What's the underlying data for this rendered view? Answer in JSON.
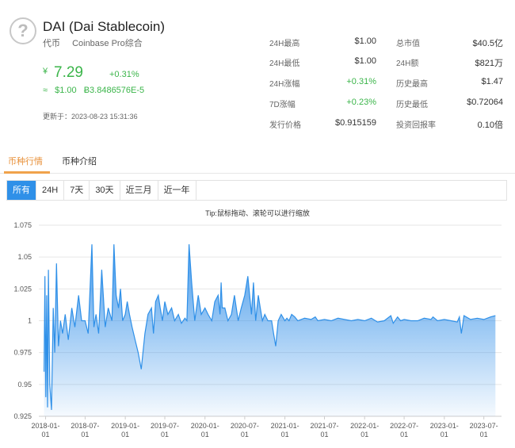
{
  "coin": {
    "icon": "question-mark-icon",
    "title": "DAI (Dai Stablecoin)",
    "type": "代币",
    "exchange": "Coinbase Pro综合",
    "cny_symbol": "¥",
    "price": "7.29",
    "change": "+0.31%",
    "approx_symbol": "≈",
    "usd_price": "$1.00",
    "btc_price": "Ƀ3.8486576E-5",
    "updated": "更新于：2023-08-23 15:31:36"
  },
  "stats_left": [
    {
      "label": "24H最高",
      "value": "$1.00",
      "color": "normal"
    },
    {
      "label": "24H最低",
      "value": "$1.00",
      "color": "normal"
    },
    {
      "label": "24H涨幅",
      "value": "+0.31%",
      "color": "green"
    },
    {
      "label": "7D涨幅",
      "value": "+0.23%",
      "color": "green"
    },
    {
      "label": "发行价格",
      "value": "$0.915159",
      "color": "normal"
    }
  ],
  "stats_right": [
    {
      "label": "总市值",
      "value": "$40.5亿"
    },
    {
      "label": "24H额",
      "value": "$821万"
    },
    {
      "label": "历史最高",
      "value": "$1.47"
    },
    {
      "label": "历史最低",
      "value": "$0.72064"
    },
    {
      "label": "投资回报率",
      "value": "0.10倍"
    }
  ],
  "tabs": [
    {
      "label": "币种行情",
      "active": true
    },
    {
      "label": "币种介绍",
      "active": false
    }
  ],
  "ranges": [
    {
      "label": "所有",
      "active": true
    },
    {
      "label": "24H",
      "active": false
    },
    {
      "label": "7天",
      "active": false
    },
    {
      "label": "30天",
      "active": false
    },
    {
      "label": "近三月",
      "active": false
    },
    {
      "label": "近一年",
      "active": false
    }
  ],
  "tip": "Tip:鼠标拖动、滚轮可以进行缩放",
  "colors": {
    "green": "#3bb54a",
    "accent": "#f0a24b",
    "line": "#2f90e8",
    "active_button": "#2f90e8"
  },
  "chart_data": {
    "type": "area",
    "ylim": [
      0.925,
      1.075
    ],
    "y_ticks": [
      "0.925",
      "0.95",
      "0.975",
      "1",
      "1.025",
      "1.05",
      "1.075"
    ],
    "x_tick_labels": [
      "2018-01-01",
      "2018-07-01",
      "2019-01-01",
      "2019-07-01",
      "2020-01-01",
      "2020-07-01",
      "2021-01-01",
      "2021-07-01",
      "2022-01-01",
      "2022-07-01",
      "2023-01-01",
      "2023-07-01"
    ],
    "x_tick_lines": [
      [
        "2018-01-",
        "01"
      ],
      [
        "2018-07-",
        "01"
      ],
      [
        "2019-01-",
        "01"
      ],
      [
        "2019-07-",
        "01"
      ],
      [
        "2020-01-",
        "01"
      ],
      [
        "2020-07-",
        "01"
      ],
      [
        "2021-01-",
        "01"
      ],
      [
        "2021-07-",
        "01"
      ],
      [
        "2022-01-",
        "01"
      ],
      [
        "2022-07-",
        "01"
      ],
      [
        "2023-01-",
        "01"
      ],
      [
        "2023-07-",
        "01"
      ]
    ],
    "series": [
      {
        "x": [
          "2017-12-25",
          "2017-12-29",
          "2018-01-02",
          "2018-01-06",
          "2018-01-10",
          "2018-01-14",
          "2018-01-20",
          "2018-01-28",
          "2018-02-05",
          "2018-02-12",
          "2018-02-20",
          "2018-03-01",
          "2018-03-10",
          "2018-03-20",
          "2018-04-01",
          "2018-04-15",
          "2018-05-01",
          "2018-05-15",
          "2018-06-01",
          "2018-06-15",
          "2018-07-01",
          "2018-07-15",
          "2018-08-01",
          "2018-08-10",
          "2018-08-20",
          "2018-09-01",
          "2018-09-15",
          "2018-10-01",
          "2018-10-15",
          "2018-11-01",
          "2018-11-10",
          "2018-11-20",
          "2018-12-01",
          "2018-12-10",
          "2018-12-20",
          "2019-01-01",
          "2019-01-10",
          "2019-01-20",
          "2019-02-01",
          "2019-02-15",
          "2019-03-01",
          "2019-03-15",
          "2019-04-01",
          "2019-04-15",
          "2019-05-01",
          "2019-05-10",
          "2019-05-20",
          "2019-06-01",
          "2019-06-10",
          "2019-06-20",
          "2019-07-01",
          "2019-07-15",
          "2019-08-01",
          "2019-08-15",
          "2019-09-01",
          "2019-09-15",
          "2019-10-01",
          "2019-10-10",
          "2019-10-20",
          "2019-11-01",
          "2019-11-15",
          "2019-12-01",
          "2019-12-15",
          "2020-01-01",
          "2020-01-15",
          "2020-02-01",
          "2020-02-15",
          "2020-03-01",
          "2020-03-10",
          "2020-03-15",
          "2020-03-20",
          "2020-04-01",
          "2020-04-15",
          "2020-05-01",
          "2020-05-15",
          "2020-06-01",
          "2020-06-15",
          "2020-07-01",
          "2020-07-15",
          "2020-08-01",
          "2020-08-10",
          "2020-08-20",
          "2020-09-01",
          "2020-09-10",
          "2020-09-20",
          "2020-10-01",
          "2020-10-15",
          "2020-11-01",
          "2020-11-10",
          "2020-11-20",
          "2020-12-01",
          "2020-12-15",
          "2021-01-01",
          "2021-01-10",
          "2021-01-20",
          "2021-02-01",
          "2021-02-15",
          "2021-03-01",
          "2021-04-01",
          "2021-05-01",
          "2021-05-20",
          "2021-06-01",
          "2021-07-01",
          "2021-08-01",
          "2021-09-01",
          "2021-10-01",
          "2021-11-01",
          "2021-12-01",
          "2022-01-01",
          "2022-02-01",
          "2022-03-01",
          "2022-04-01",
          "2022-05-01",
          "2022-05-12",
          "2022-06-01",
          "2022-06-15",
          "2022-07-01",
          "2022-08-01",
          "2022-09-01",
          "2022-10-01",
          "2022-11-01",
          "2022-11-10",
          "2022-12-01",
          "2023-01-01",
          "2023-02-01",
          "2023-03-01",
          "2023-03-11",
          "2023-03-20",
          "2023-04-01",
          "2023-05-01",
          "2023-06-01",
          "2023-07-01",
          "2023-08-01",
          "2023-08-23"
        ],
        "y": [
          0.96,
          1.035,
          0.94,
          1.02,
          0.932,
          1.04,
          0.95,
          0.93,
          1.01,
          0.975,
          1.045,
          0.98,
          1.0,
          0.99,
          1.005,
          0.985,
          1.01,
          0.995,
          1.02,
          1.0,
          1.0,
          0.99,
          1.06,
          0.995,
          1.005,
          0.99,
          1.04,
          0.995,
          1.01,
          1.0,
          1.06,
          1.02,
          1.01,
          1.025,
          1.0,
          1.005,
          1.015,
          1.005,
          0.995,
          0.985,
          0.975,
          0.962,
          0.99,
          1.005,
          1.01,
          0.99,
          1.015,
          1.02,
          1.01,
          1.0,
          1.015,
          1.005,
          1.01,
          1.0,
          1.005,
          0.998,
          1.002,
          1.0,
          1.06,
          1.03,
          1.0,
          1.02,
          1.005,
          1.01,
          1.005,
          1.0,
          1.015,
          1.02,
          1.005,
          1.03,
          1.01,
          1.01,
          1.0,
          1.005,
          1.02,
          1.0,
          1.01,
          1.02,
          1.035,
          1.005,
          1.03,
          1.0,
          1.02,
          1.01,
          1.0,
          1.005,
          1.0,
          1.0,
          0.99,
          0.98,
          1.0,
          1.005,
          1.0,
          1.002,
          1.0,
          1.005,
          1.003,
          1.0,
          1.002,
          1.001,
          1.003,
          1.0,
          1.001,
          1.0,
          1.002,
          1.001,
          1.0,
          1.001,
          1.0,
          1.002,
          0.999,
          1.0,
          1.004,
          0.998,
          1.003,
          1.0,
          1.001,
          1.0,
          1.0,
          1.002,
          1.001,
          1.003,
          1.0,
          1.001,
          1.0,
          0.999,
          1.003,
          0.99,
          1.004,
          1.001,
          1.002,
          1.001,
          1.003,
          1.004
        ]
      }
    ]
  }
}
